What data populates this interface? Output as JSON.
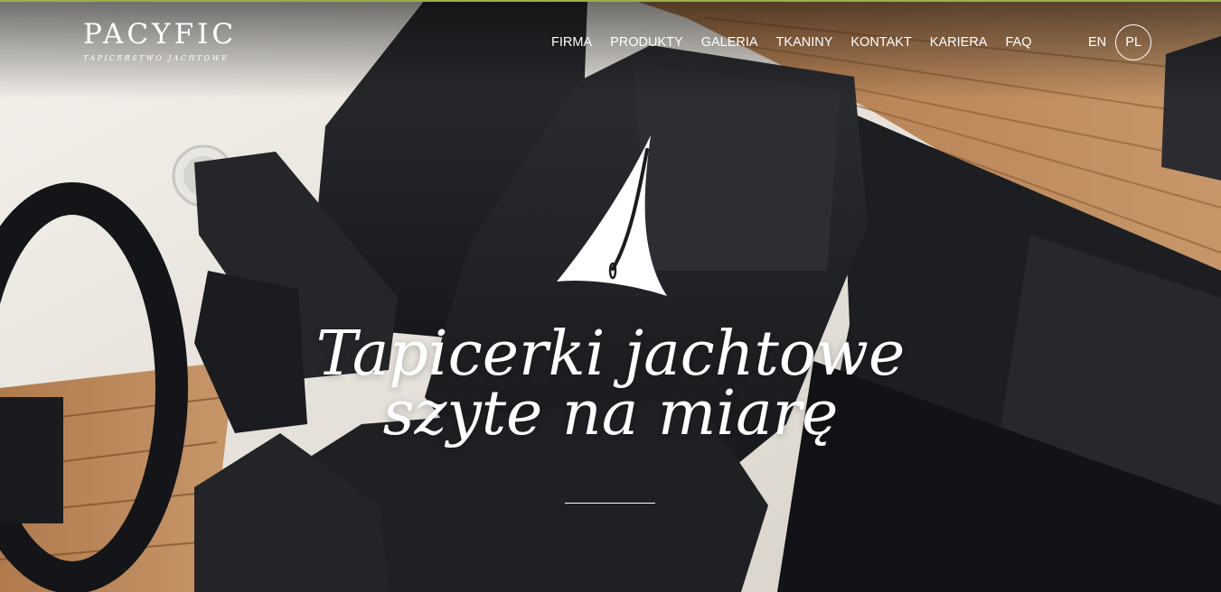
{
  "brand": {
    "name": "PACYFIC",
    "tagline": "TAPICERSTWO JACHTOWE"
  },
  "nav": {
    "items": [
      "FIRMA",
      "PRODUKTY",
      "GALERIA",
      "TKANINY",
      "KONTAKT",
      "KARIERA",
      "FAQ"
    ]
  },
  "languages": {
    "en": "EN",
    "pl": "PL",
    "active": "PL"
  },
  "hero": {
    "line1": "Tapicerki jachtowe",
    "line2": "szyte na miarę",
    "background_icon": "boat-seats-photo"
  },
  "colors": {
    "accent_top_line": "#9cb04a",
    "text": "#ffffff"
  }
}
